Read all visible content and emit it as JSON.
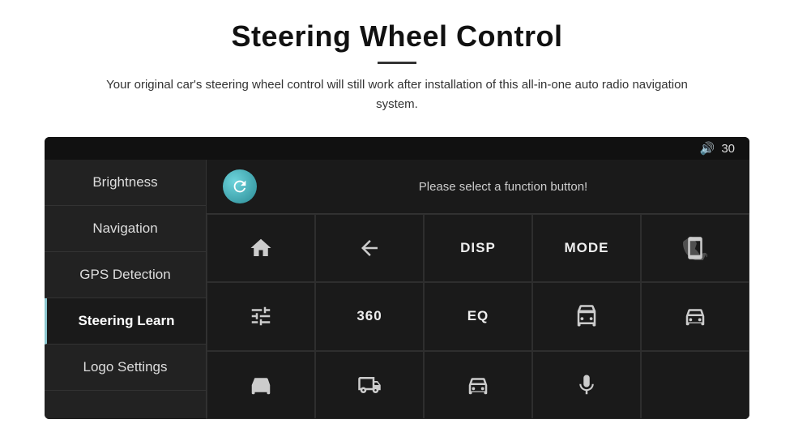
{
  "header": {
    "title": "Steering Wheel Control",
    "divider": true,
    "subtitle": "Your original car's steering wheel control will still work after installation of this all-in-one auto radio navigation system."
  },
  "topbar": {
    "volume_icon": "🔊",
    "volume_value": "30"
  },
  "sidebar": {
    "items": [
      {
        "id": "brightness",
        "label": "Brightness",
        "active": false
      },
      {
        "id": "navigation",
        "label": "Navigation",
        "active": false
      },
      {
        "id": "gps-detection",
        "label": "GPS Detection",
        "active": false
      },
      {
        "id": "steering-learn",
        "label": "Steering Learn",
        "active": true
      },
      {
        "id": "logo-settings",
        "label": "Logo Settings",
        "active": false
      }
    ]
  },
  "main": {
    "sync_icon": "↻",
    "status_text": "Please select a function button!",
    "grid": [
      [
        {
          "type": "icon",
          "name": "home-icon",
          "icon": "home"
        },
        {
          "type": "icon",
          "name": "back-icon",
          "icon": "back"
        },
        {
          "type": "text",
          "name": "disp-button",
          "label": "DISP"
        },
        {
          "type": "text",
          "name": "mode-button",
          "label": "MODE"
        },
        {
          "type": "icon",
          "name": "no-phone-icon",
          "icon": "nophone"
        }
      ],
      [
        {
          "type": "icon",
          "name": "tune-icon",
          "icon": "tune"
        },
        {
          "type": "text",
          "name": "360-button",
          "label": "360"
        },
        {
          "type": "text",
          "name": "eq-button",
          "label": "EQ"
        },
        {
          "type": "icon",
          "name": "car1-icon",
          "icon": "car1"
        },
        {
          "type": "icon",
          "name": "car2-icon",
          "icon": "car2"
        }
      ],
      [
        {
          "type": "icon",
          "name": "car-top-icon",
          "icon": "cartop"
        },
        {
          "type": "icon",
          "name": "car-front-icon",
          "icon": "carfront"
        },
        {
          "type": "icon",
          "name": "car-side-icon",
          "icon": "carside"
        },
        {
          "type": "icon",
          "name": "mic-icon",
          "icon": "mic"
        },
        {
          "type": "empty",
          "name": "empty-cell",
          "label": ""
        }
      ]
    ]
  }
}
